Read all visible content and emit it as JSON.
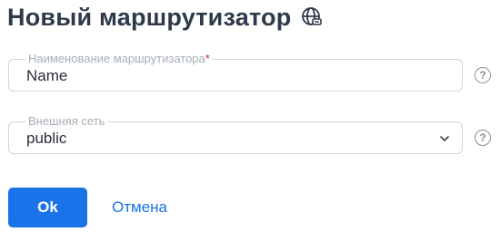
{
  "header": {
    "title": "Новый маршрутизатор",
    "icon": "globe-network-icon"
  },
  "form": {
    "router_name": {
      "label": "Наименование маршрутизатора",
      "required_mark": "*",
      "value": "Name",
      "help": "?"
    },
    "external_network": {
      "label": "Внешняя сеть",
      "value": "public",
      "help": "?",
      "dropdown_icon": "chevron-down-icon"
    }
  },
  "actions": {
    "ok_label": "Ok",
    "cancel_label": "Отмена"
  },
  "colors": {
    "primary": "#1a73e8",
    "title": "#2e3a4b",
    "border": "#cfd5dc",
    "label": "#a7aeb7",
    "required": "#c0392b"
  }
}
